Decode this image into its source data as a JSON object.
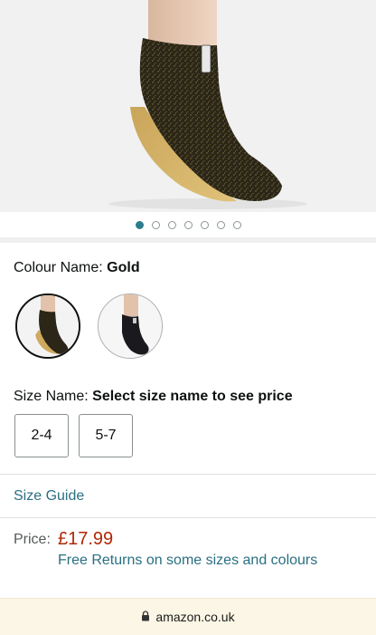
{
  "product": {
    "image_alt": "Gold glitter sock shoe",
    "carousel": {
      "count": 7,
      "active_index": 0
    }
  },
  "colour": {
    "label": "Colour Name:",
    "value": "Gold",
    "options": [
      {
        "name": "Gold",
        "selected": true
      },
      {
        "name": "Black",
        "selected": false
      }
    ]
  },
  "size": {
    "label": "Size Name:",
    "prompt": "Select size name to see price",
    "options": [
      "2-4",
      "5-7"
    ]
  },
  "size_guide": {
    "label": "Size Guide"
  },
  "price": {
    "label": "Price:",
    "value": "£17.99",
    "returns_text": "Free Returns on some sizes and colours"
  },
  "browser": {
    "url": "amazon.co.uk",
    "icon": "lock-icon"
  },
  "colors": {
    "link": "#2a6f82",
    "price": "#b12704",
    "carousel_active": "#2d7d8c"
  }
}
